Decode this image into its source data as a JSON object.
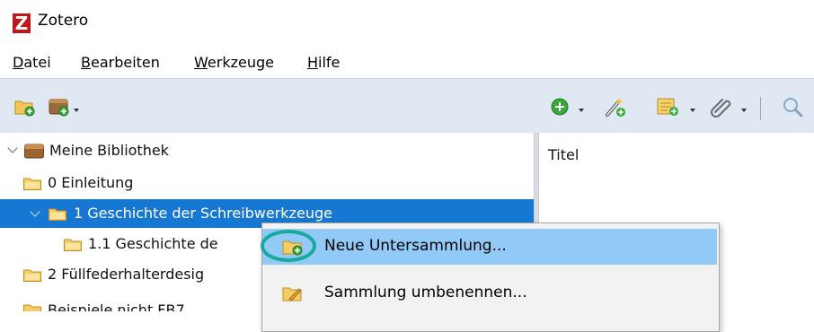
{
  "window": {
    "title": "Zotero",
    "logo_letter": "Z",
    "brand_color": "#c0161c"
  },
  "menu": {
    "items": [
      {
        "accel": "D",
        "rest": "atei"
      },
      {
        "accel": "B",
        "rest": "earbeiten"
      },
      {
        "accel": "W",
        "rest": "erkzeuge"
      },
      {
        "accel": "H",
        "rest": "ilfe"
      }
    ]
  },
  "toolbar": {
    "left_icons": [
      "new-collection-icon",
      "new-library-icon"
    ],
    "right_icons": [
      "new-item-icon",
      "add-by-identifier-icon",
      "new-note-icon",
      "attachment-icon",
      "search-icon"
    ]
  },
  "tree": {
    "items": [
      {
        "label": "Meine Bibliothek"
      },
      {
        "label": "0 Einleitung"
      },
      {
        "label": "1 Geschichte der Schreibwerkzeuge"
      },
      {
        "label": "1.1 Geschichte de"
      },
      {
        "label": "2 Füllfederhalterdesig"
      },
      {
        "label": "Beispiele nicht FB7"
      }
    ],
    "selected_index": 2
  },
  "items_pane": {
    "column_title": "Titel"
  },
  "context_menu": {
    "items": [
      {
        "label": "Neue Untersammlung..."
      },
      {
        "label": "Sammlung umbenennen..."
      }
    ],
    "highlight_color": "#91c9f7",
    "annotation_color": "#19a99a"
  },
  "colors": {
    "selection": "#1778d3",
    "toolbar_bg": "#dfe8f3"
  }
}
